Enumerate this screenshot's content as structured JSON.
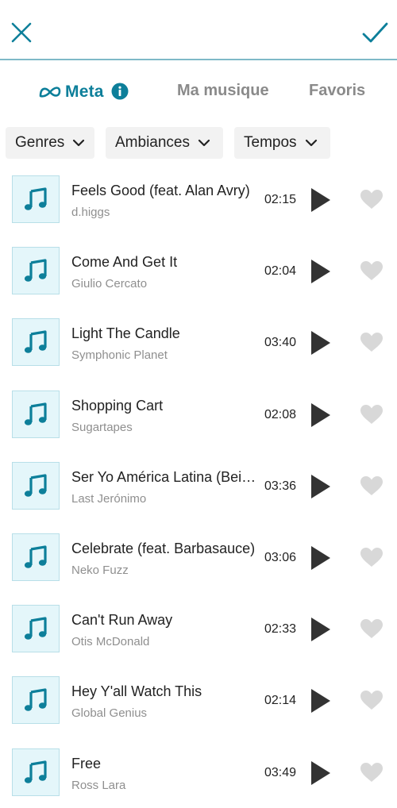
{
  "header": {
    "close_icon": "close-icon",
    "confirm_icon": "check-icon"
  },
  "tabs": {
    "meta_label": "Meta",
    "my_music_label": "Ma musique",
    "favorites_label": "Favoris"
  },
  "filters": [
    {
      "label": "Genres"
    },
    {
      "label": "Ambiances"
    },
    {
      "label": "Tempos"
    }
  ],
  "tracks": [
    {
      "title": "Feels Good (feat. Alan Avry)",
      "artist": "d.higgs",
      "duration": "02:15"
    },
    {
      "title": "Come And Get It",
      "artist": "Giulio Cercato",
      "duration": "02:04"
    },
    {
      "title": "Light The Candle",
      "artist": "Symphonic Planet",
      "duration": "03:40"
    },
    {
      "title": "Shopping Cart",
      "artist": "Sugartapes",
      "duration": "02:08"
    },
    {
      "title": "Ser Yo América Latina (Being Latin America)",
      "artist": "Last Jerónimo",
      "duration": "03:36"
    },
    {
      "title": "Celebrate (feat. Barbasauce)",
      "artist": "Neko Fuzz",
      "duration": "03:06"
    },
    {
      "title": "Can't Run Away",
      "artist": "Otis McDonald",
      "duration": "02:33"
    },
    {
      "title": "Hey Y'all Watch This",
      "artist": "Global Genius",
      "duration": "02:14"
    },
    {
      "title": "Free",
      "artist": "Ross Lara",
      "duration": "03:49"
    }
  ],
  "colors": {
    "accent": "#0d7f9a",
    "divider": "#7fb9c7",
    "thumb_bg": "#e4f6fa",
    "heart": "#d8d8d8"
  }
}
